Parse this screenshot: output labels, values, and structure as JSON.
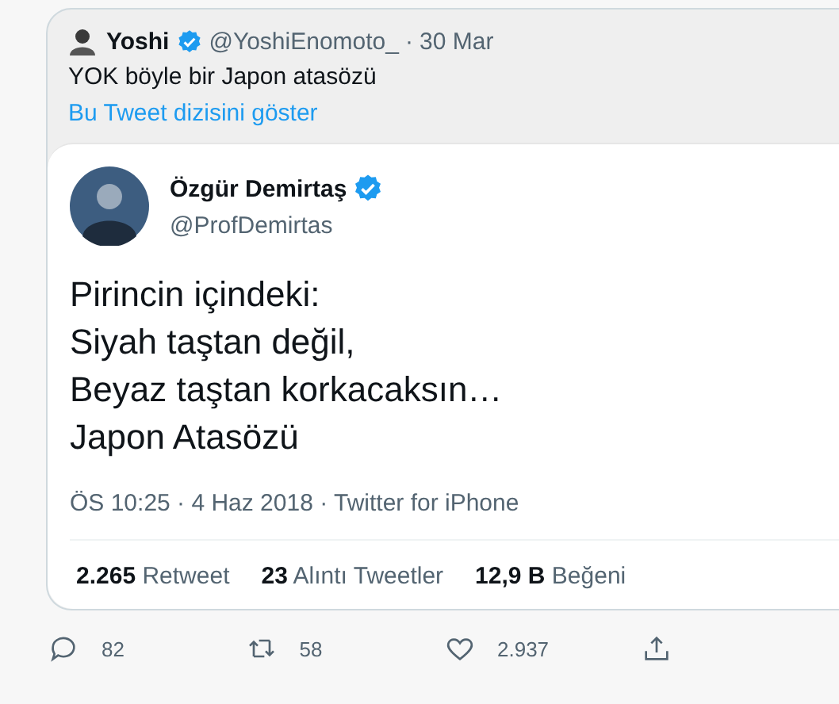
{
  "parent_tweet": {
    "author": "Yoshi",
    "verified": true,
    "handle": "@YoshiEnomoto_",
    "separator": "·",
    "date": "30 Mar",
    "text": "YOK böyle bir Japon atasözü",
    "thread_link": "Bu Tweet dizisini göster"
  },
  "quoted_tweet": {
    "author": "Özgür Demirtaş",
    "verified": true,
    "handle": "@ProfDemirtas",
    "lines": [
      "Pirincin içindeki:",
      "Siyah taştan değil,",
      "Beyaz taştan korkacaksın…",
      "Japon Atasözü"
    ],
    "meta": "ÖS 10:25 · 4 Haz 2018 · Twitter for iPhone",
    "stats": [
      {
        "count": "2.265",
        "label": "Retweet"
      },
      {
        "count": "23",
        "label": "Alıntı Tweetler"
      },
      {
        "count": "12,9 B",
        "label": "Beğeni"
      }
    ]
  },
  "actions": [
    {
      "kind": "reply",
      "count": "82"
    },
    {
      "kind": "retweet",
      "count": "58"
    },
    {
      "kind": "like",
      "count": "2.937"
    },
    {
      "kind": "share"
    }
  ]
}
